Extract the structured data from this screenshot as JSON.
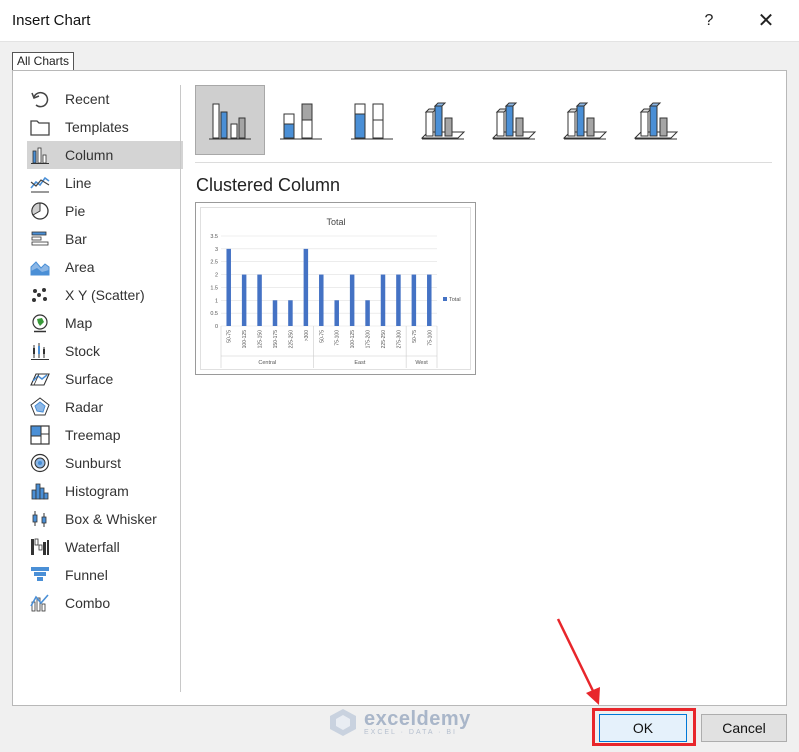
{
  "window": {
    "title": "Insert Chart",
    "help": "?",
    "close": "✕"
  },
  "tab": "All Charts",
  "chart_types": [
    {
      "label": "Recent",
      "icon": "recent-icon"
    },
    {
      "label": "Templates",
      "icon": "templates-icon"
    },
    {
      "label": "Column",
      "icon": "column-chart-icon",
      "selected": true
    },
    {
      "label": "Line",
      "icon": "line-chart-icon"
    },
    {
      "label": "Pie",
      "icon": "pie-chart-icon"
    },
    {
      "label": "Bar",
      "icon": "bar-chart-icon"
    },
    {
      "label": "Area",
      "icon": "area-chart-icon"
    },
    {
      "label": "X Y (Scatter)",
      "icon": "scatter-chart-icon"
    },
    {
      "label": "Map",
      "icon": "map-chart-icon"
    },
    {
      "label": "Stock",
      "icon": "stock-chart-icon"
    },
    {
      "label": "Surface",
      "icon": "surface-chart-icon"
    },
    {
      "label": "Radar",
      "icon": "radar-chart-icon"
    },
    {
      "label": "Treemap",
      "icon": "treemap-chart-icon"
    },
    {
      "label": "Sunburst",
      "icon": "sunburst-chart-icon"
    },
    {
      "label": "Histogram",
      "icon": "histogram-chart-icon"
    },
    {
      "label": "Box & Whisker",
      "icon": "box-whisker-chart-icon"
    },
    {
      "label": "Waterfall",
      "icon": "waterfall-chart-icon"
    },
    {
      "label": "Funnel",
      "icon": "funnel-chart-icon"
    },
    {
      "label": "Combo",
      "icon": "combo-chart-icon"
    }
  ],
  "subtypes": [
    {
      "icon": "clustered-column-icon",
      "selected": true
    },
    {
      "icon": "stacked-column-icon"
    },
    {
      "icon": "100-stacked-column-icon"
    },
    {
      "icon": "3d-clustered-column-icon"
    },
    {
      "icon": "3d-stacked-column-icon"
    },
    {
      "icon": "3d-100-stacked-column-icon"
    },
    {
      "icon": "3d-column-icon"
    }
  ],
  "selected_subtype_title": "Clustered Column",
  "chart_data": {
    "type": "bar",
    "title": "Total",
    "categories": [
      "50-75",
      "100-125",
      "125-150",
      "150-175",
      "225-250",
      ">300",
      "50-75",
      "75-100",
      "100-125",
      "175-200",
      "225-250",
      "275-300",
      "50-75",
      "75-100"
    ],
    "groups": [
      {
        "label": "Central",
        "count": 6
      },
      {
        "label": "East",
        "count": 6
      },
      {
        "label": "West",
        "count": 2
      }
    ],
    "series": [
      {
        "name": "Total",
        "values": [
          3,
          2,
          2,
          1,
          1,
          3,
          2,
          1,
          2,
          1,
          2,
          2,
          2,
          2
        ]
      }
    ],
    "yticks": [
      "0",
      "0.5",
      "1",
      "1.5",
      "2",
      "2.5",
      "3",
      "3.5"
    ],
    "ylim": [
      0,
      3.5
    ],
    "grid": true,
    "legend": "right",
    "color": "#4472c4"
  },
  "watermark": {
    "name": "exceldemy",
    "sub": "EXCEL · DATA · BI"
  },
  "buttons": {
    "ok": "OK",
    "cancel": "Cancel"
  },
  "colors": {
    "highlight": "#e8262b",
    "accent": "#4472c4"
  }
}
